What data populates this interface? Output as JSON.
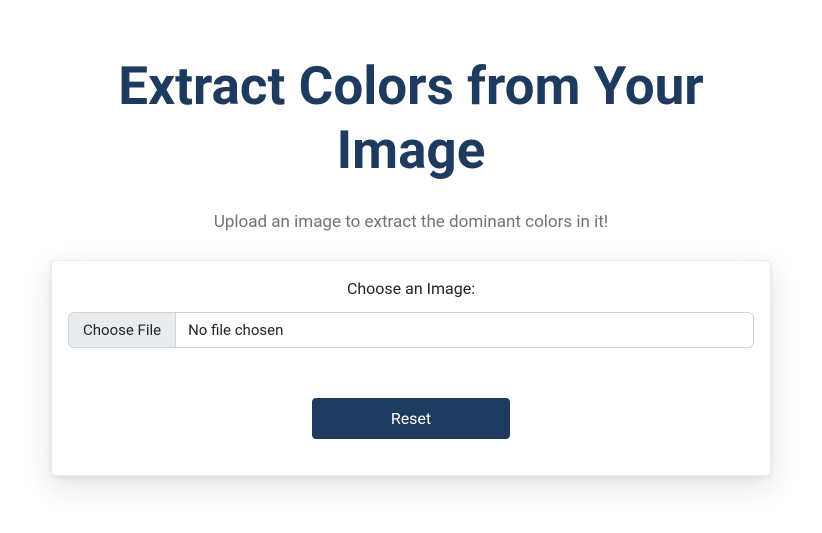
{
  "colors": {
    "brand_dark": "#1e3a5f",
    "muted_text": "#6c757d"
  },
  "header": {
    "title": "Extract Colors from Your Image",
    "subtitle": "Upload an image to extract the dominant colors in it!"
  },
  "form": {
    "label": "Choose an Image:",
    "file_button_label": "Choose File",
    "file_status_text": "No file chosen",
    "reset_label": "Reset"
  }
}
